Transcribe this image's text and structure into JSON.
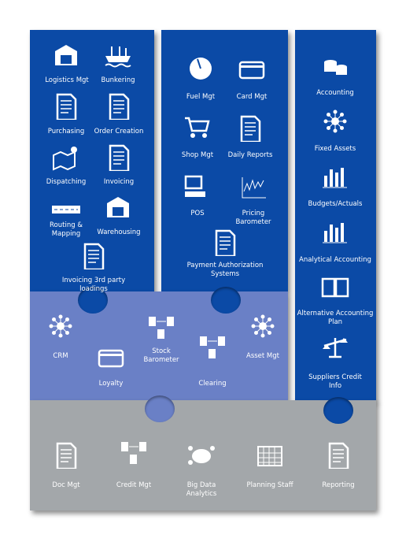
{
  "colors": {
    "panel_blue": "#0b4aa6",
    "panel_lavender": "#6a80c6",
    "panel_gray": "#a3a7aa",
    "icon": "#ffffff"
  },
  "panels": {
    "operations": [
      {
        "label": "Logistics Mgt",
        "icon": "warehouse-truck-icon"
      },
      {
        "label": "Bunkering",
        "icon": "ship-icon"
      },
      {
        "label": "Purchasing",
        "icon": "document-pen-icon"
      },
      {
        "label": "Order Creation",
        "icon": "checklist-icon"
      },
      {
        "label": "Dispatching",
        "icon": "map-pin-icon"
      },
      {
        "label": "Invoicing",
        "icon": "invoice-icon"
      },
      {
        "label": "Routing &\nMapping",
        "icon": "road-icon"
      },
      {
        "label": "Warehousing",
        "icon": "warehouse-icon"
      },
      {
        "label": "Invoicing 3rd party loadings",
        "icon": "invoice-icon"
      }
    ],
    "retail": [
      {
        "label": "Fuel Mgt",
        "icon": "fuel-gauge-icon"
      },
      {
        "label": "Card Mgt",
        "icon": "card-hand-icon"
      },
      {
        "label": "Shop Mgt",
        "icon": "cart-icon"
      },
      {
        "label": "Daily Reports",
        "icon": "report-chart-icon"
      },
      {
        "label": "POS",
        "icon": "pos-terminal-icon"
      },
      {
        "label": "Pricing\nBarometer",
        "icon": "price-chart-icon"
      },
      {
        "label": "Payment Authorization\nSystems",
        "icon": "document-pen-icon"
      }
    ],
    "finance": [
      {
        "label": "Accounting",
        "icon": "coins-icon"
      },
      {
        "label": "Fixed Assets",
        "icon": "network-icon"
      },
      {
        "label": "Budgets/Actuals",
        "icon": "bar-chart-icon"
      },
      {
        "label": "Analytical Accounting",
        "icon": "bar-chart-icon"
      },
      {
        "label": "Alternative Accounting\nPlan",
        "icon": "book-icon"
      },
      {
        "label": "Suppliers Credit\nInfo",
        "icon": "scale-icon"
      }
    ],
    "customer": [
      {
        "label": "CRM",
        "icon": "network-icon"
      },
      {
        "label": "Loyalty",
        "icon": "card-icon"
      },
      {
        "label": "Stock\nBarometer",
        "icon": "tanks-icon"
      },
      {
        "label": "Clearing",
        "icon": "exchange-icon"
      },
      {
        "label": "Asset Mgt",
        "icon": "network-icon"
      }
    ],
    "support": [
      {
        "label": "Doc Mgt",
        "icon": "document-icon"
      },
      {
        "label": "Credit Mgt",
        "icon": "exchange-icon"
      },
      {
        "label": "Big Data\nAnalytics",
        "icon": "cloud-database-icon"
      },
      {
        "label": "Planning Staff",
        "icon": "calendar-icon"
      },
      {
        "label": "Reporting",
        "icon": "report-chart-icon"
      }
    ]
  }
}
